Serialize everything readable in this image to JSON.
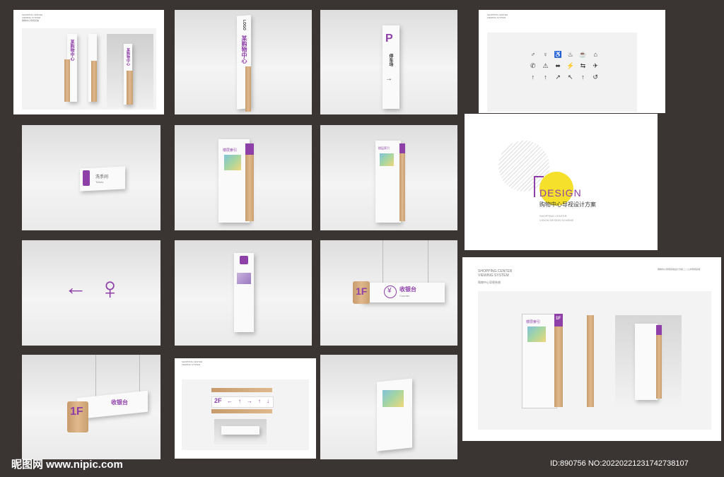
{
  "sheets": {
    "header_title": "SHOPPING CENTER",
    "header_sub": "VIEWING SYSTEM",
    "header_cn": "购物中心导视系统",
    "header_page": "辅助立牌",
    "header_right": "购物中心导视系统设计方案 二 |  公共导视系统"
  },
  "tile1": {
    "pillar_label": "某购物中心",
    "logo": "LOGO"
  },
  "tile2": {
    "logo": "LOGO",
    "label": "某购物中心"
  },
  "tile3": {
    "parking_letter": "P",
    "label": "停车场",
    "arrow": "→"
  },
  "tile4": {
    "icons": [
      "♂",
      "♀",
      "♿",
      "♨",
      "☕",
      "⌂",
      "✆",
      "⚠",
      "⬌",
      "⚡",
      "⇆",
      "✈",
      "↑",
      "↑",
      "↗",
      "↖",
      "↑",
      "↺"
    ]
  },
  "cover": {
    "design": "DESIGN",
    "title_cn": "购物中心导视设计方案",
    "sub1": "SHOPPING CENTER",
    "sub2": "VISION DESIGN SCHEME"
  },
  "wall_sign": {
    "label": "洗手间",
    "label_en": "Toilets"
  },
  "directory": {
    "title": "楼层索引",
    "floor": "1F"
  },
  "counter": {
    "floor": "1F",
    "label": "收银台",
    "label_en": "Counter",
    "yuan": "¥"
  },
  "direction": {
    "arrow": "←",
    "person": "♀"
  },
  "corridor": {
    "floor": "2F",
    "arrows": [
      "←",
      "↑",
      "→",
      "↑",
      "↓"
    ]
  },
  "watermark": {
    "brand": "昵图网 www.nipic.com",
    "id": "ID:890756 NO:20220221231742738107"
  }
}
